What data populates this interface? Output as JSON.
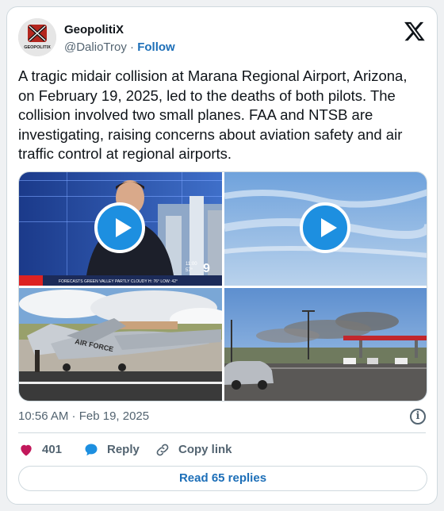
{
  "author": {
    "display_name": "GeopolitiX",
    "handle": "@DalioTroy",
    "follow_label": "Follow",
    "avatar_text": "GEOPOLITIX"
  },
  "tweet": {
    "text": "A tragic midair collision at Marana Regional Airport, Arizona, on February 19, 2025, led to the deaths of both pilots. The collision involved two small planes. FAA and NTSB are investigating, raising concerns about aviation safety and air traffic control at regional airports.",
    "timestamp": "10:56 AM · Feb 19, 2025"
  },
  "media": {
    "news_ticker": "FORECASTS   GREEN VALLEY   PARTLY CLOUDY   H: 76°  LOW: 42°",
    "news_channel": "9",
    "news_time": "11:00",
    "news_temp": "57°",
    "plane_text": "AIR FORCE"
  },
  "actions": {
    "likes": "401",
    "reply_label": "Reply",
    "copy_label": "Copy link",
    "read_replies": "Read 65 replies"
  },
  "colors": {
    "accent": "#1d6fb8",
    "play_button": "#1d8fe0",
    "like": "#f91880"
  }
}
